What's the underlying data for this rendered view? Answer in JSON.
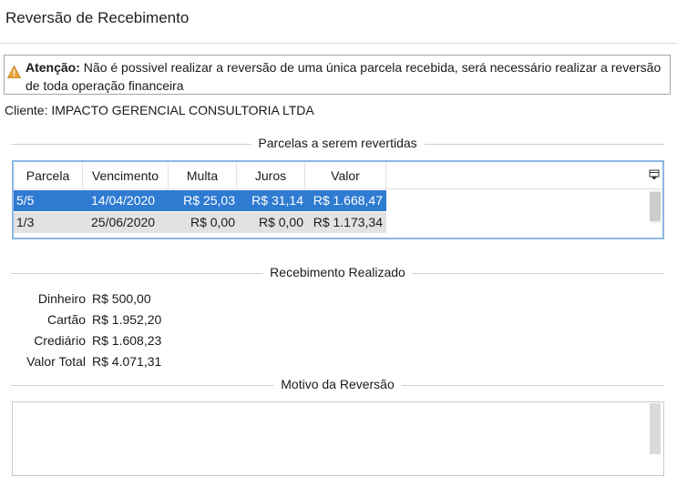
{
  "window": {
    "title": "Reversão de Recebimento"
  },
  "warning": {
    "label": "Atenção:",
    "message": " Não é possivel realizar a reversão de uma única parcela recebida, será necessário realizar a reversão de toda operação financeira",
    "icon": "warning-icon",
    "icon_color": "#e8a33a"
  },
  "client": {
    "text": "Cliente: IMPACTO GERENCIAL CONSULTORIA LTDA"
  },
  "installments": {
    "section_title": "Parcelas a serem revertidas",
    "columns": [
      "Parcela",
      "Vencimento",
      "Multa",
      "Juros",
      "Valor"
    ],
    "rows": [
      {
        "parcela": "5/5",
        "vencimento": "14/04/2020",
        "multa": "R$ 25,03",
        "juros": "R$ 31,14",
        "valor": "R$ 1.668,47",
        "selected": true
      },
      {
        "parcela": "1/3",
        "vencimento": "25/06/2020",
        "multa": "R$ 0,00",
        "juros": "R$ 0,00",
        "valor": "R$ 1.173,34",
        "selected": false
      }
    ],
    "selection_color": "#2f7bd1"
  },
  "received": {
    "section_title": "Recebimento Realizado",
    "items": [
      {
        "label": "Dinheiro",
        "value": "R$ 500,00"
      },
      {
        "label": "Cartão",
        "value": "R$ 1.952,20"
      },
      {
        "label": "Crediário",
        "value": "R$ 1.608,23"
      },
      {
        "label": "Valor Total",
        "value": "R$ 4.071,31"
      }
    ]
  },
  "reason": {
    "section_title": "Motivo da Reversão",
    "value": ""
  }
}
